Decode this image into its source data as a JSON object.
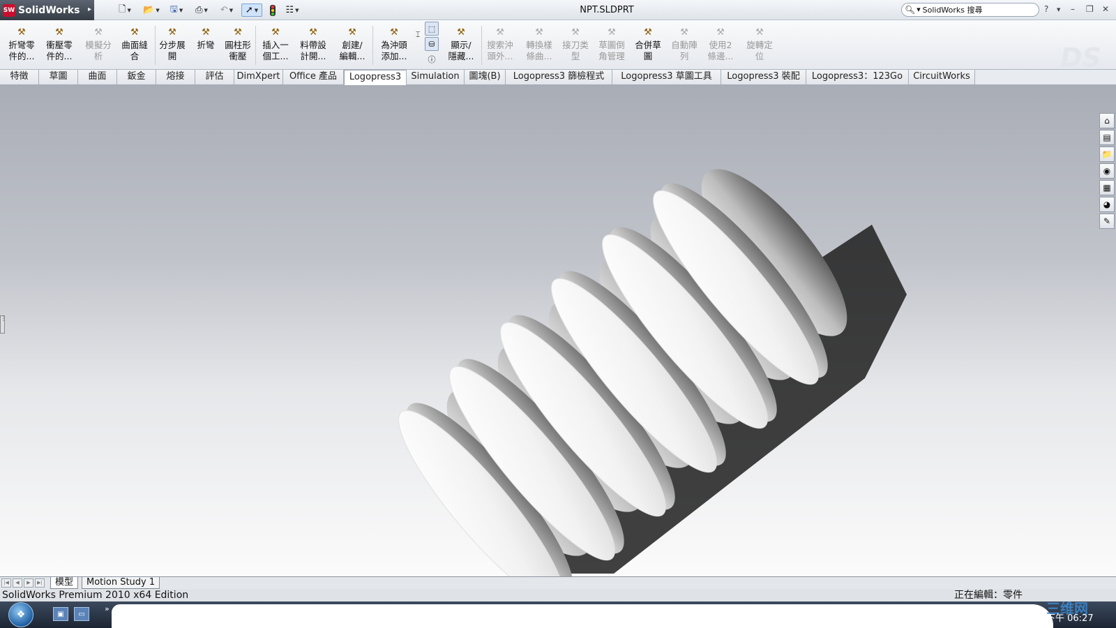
{
  "app": {
    "name": "SolidWorks",
    "document_title": "NPT.SLDPRT"
  },
  "search": {
    "placeholder": "SolidWorks 搜尋"
  },
  "ribbon": {
    "buttons": [
      {
        "label": "折彎零\n件的...",
        "icon": "sheetmetal-fold-icon",
        "enabled": true
      },
      {
        "label": "衝壓零\n件的...",
        "icon": "stamp-part-icon",
        "enabled": true
      },
      {
        "label": "模擬分\n析",
        "icon": "simulation-icon",
        "enabled": false
      },
      {
        "label": "曲面縫\n合",
        "icon": "surface-knit-icon",
        "enabled": true
      },
      {
        "label": "分步展\n開",
        "icon": "step-unfold-icon",
        "enabled": true
      },
      {
        "label": "折彎",
        "icon": "bend-icon",
        "enabled": true
      },
      {
        "label": "圓柱形\n衝壓",
        "icon": "cylinder-stamp-icon",
        "enabled": true
      },
      {
        "label": "插入一\n個工...",
        "icon": "insert-station-icon",
        "enabled": true
      },
      {
        "label": "料帶設\n計開...",
        "icon": "strip-design-icon",
        "enabled": true
      },
      {
        "label": "創建/\n編輯...",
        "icon": "create-edit-icon",
        "enabled": true
      },
      {
        "label": "為沖頭\n添加...",
        "icon": "punch-add-icon",
        "enabled": true
      },
      {
        "label": "顯示/\n隱藏...",
        "icon": "show-hide-icon",
        "enabled": true
      },
      {
        "label": "搜索沖\n頭外...",
        "icon": "punch-search-icon",
        "enabled": false
      },
      {
        "label": "轉換樣\n條曲...",
        "icon": "spline-convert-icon",
        "enabled": false
      },
      {
        "label": "接刀类\n型",
        "icon": "cutter-type-icon",
        "enabled": false
      },
      {
        "label": "草圖倒\n角管理",
        "icon": "sketch-chamfer-icon",
        "enabled": false
      },
      {
        "label": "合併草\n圖",
        "icon": "merge-sketch-icon",
        "enabled": true
      },
      {
        "label": "自動陣\n列",
        "icon": "auto-pattern-icon",
        "enabled": false
      },
      {
        "label": "使用2\n條邊...",
        "icon": "two-edges-icon",
        "enabled": false
      },
      {
        "label": "旋轉定\n位",
        "icon": "rotate-position-icon",
        "enabled": false
      }
    ]
  },
  "command_tabs": [
    {
      "label": "特徵",
      "active": false
    },
    {
      "label": "草圖",
      "active": false
    },
    {
      "label": "曲面",
      "active": false
    },
    {
      "label": "鈑金",
      "active": false
    },
    {
      "label": "熔接",
      "active": false
    },
    {
      "label": "評估",
      "active": false
    },
    {
      "label": "DimXpert",
      "active": false
    },
    {
      "label": "Office 產品",
      "active": false
    },
    {
      "label": "Logopress3",
      "active": true
    },
    {
      "label": "Simulation",
      "active": false
    },
    {
      "label": "圖塊(B)",
      "active": false
    },
    {
      "label": "Logopress3 篩檢程式",
      "active": false
    },
    {
      "label": "Logopress3 草圖工具",
      "active": false
    },
    {
      "label": "Logopress3 裝配",
      "active": false
    },
    {
      "label": "Logopress3：123Go",
      "active": false
    },
    {
      "label": "CircuitWorks",
      "active": false
    }
  ],
  "bottom_tabs": [
    {
      "label": "模型",
      "active": true
    },
    {
      "label": "Motion Study 1",
      "active": false
    }
  ],
  "status": {
    "left": "SolidWorks Premium 2010 x64 Edition",
    "right": "正在編輯：零件"
  },
  "taskbar": {
    "clock": "下午 06:27",
    "watermark": "三维网"
  },
  "colors": {
    "title_gradient_top": "#f4f6f9",
    "logo_red": "#c8102e",
    "viewport_top": "#a9adb6",
    "viewport_bottom": "#fbfbfb",
    "taskbar": "#1c2533"
  }
}
